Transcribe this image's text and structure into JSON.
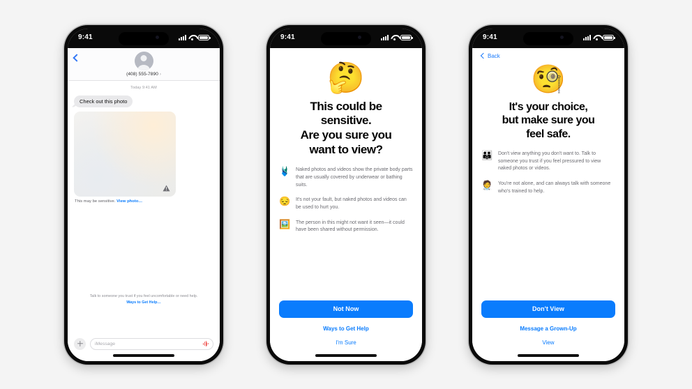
{
  "background_color": "#f4f4f4",
  "accent_blue": "#0a7cfd",
  "phones": {
    "messages": {
      "status_bar": {
        "time": "9:41",
        "signal_icon": "cellular-signal-icon",
        "wifi_icon": "wifi-icon",
        "battery_icon": "battery-icon"
      },
      "nav": {
        "back_icon": "back-chevron-icon",
        "avatar_icon": "contact-avatar-icon",
        "contact": "(408) 555-7890",
        "disclosure": "›"
      },
      "thread": {
        "timestamp": "Today 9:41 AM",
        "incoming_message": "Check out this photo",
        "attachment_warning_icon": "warning-triangle-icon",
        "sensitive_label": "This may be sensitive.",
        "view_photo_link": "View photo…"
      },
      "footer": {
        "help_text": "Talk to someone you trust if you feel uncomfortable or need help.",
        "help_link": "Ways to Get Help…"
      },
      "composer": {
        "plus_icon": "plus-icon",
        "placeholder": "iMessage",
        "audio_icon": "audio-waveform-icon"
      }
    },
    "sensitive_warning": {
      "status_bar": {
        "time": "9:41"
      },
      "hero_emoji": "🤔",
      "hero_emoji_name": "thinking-face-emoji",
      "title_line1": "This could be",
      "title_line2": "sensitive.",
      "title_line3": "Are you sure you",
      "title_line4": "want to view?",
      "bullets": [
        {
          "icon": "🩱",
          "icon_name": "swimsuit-emoji",
          "text": "Naked photos and videos show the private body parts that are usually covered by underwear or bathing suits."
        },
        {
          "icon": "😔",
          "icon_name": "pensive-face-emoji",
          "text": "It's not your fault, but naked photos and videos can be used to hurt you."
        },
        {
          "icon": "🖼️",
          "icon_name": "framed-picture-emoji",
          "text": "The person in this might not want it seen—it could have been shared without permission."
        }
      ],
      "primary_button": "Not Now",
      "secondary_link": "Ways to Get Help",
      "tertiary_link": "I'm Sure"
    },
    "your_choice": {
      "status_bar": {
        "time": "9:41"
      },
      "nav_back": "Back",
      "hero_emoji": "🧐",
      "hero_emoji_name": "face-with-monocle-emoji",
      "title_line1": "It's your choice,",
      "title_line2": "but make sure you",
      "title_line3": "feel safe.",
      "bullets": [
        {
          "icon": "👪",
          "icon_name": "family-emoji",
          "text": "Don't view anything you don't want to. Talk to someone you trust if you feel pressured to view naked photos or videos."
        },
        {
          "icon": "🧑‍⚕️",
          "icon_name": "health-worker-emoji",
          "text": "You're not alone, and can always talk with someone who's trained to help."
        }
      ],
      "primary_button": "Don't View",
      "secondary_link": "Message a Grown-Up",
      "tertiary_link": "View"
    }
  }
}
